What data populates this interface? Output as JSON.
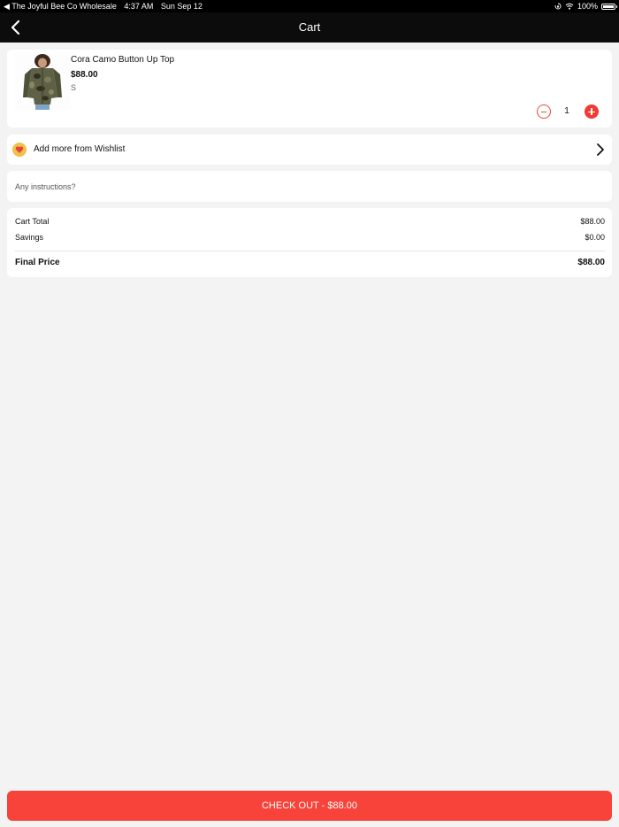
{
  "status_bar": {
    "back_app": "◀ The Joyful Bee Co Wholesale",
    "time": "4:37 AM",
    "date": "Sun Sep 12",
    "battery": "100%"
  },
  "header": {
    "title": "Cart"
  },
  "cart": {
    "items": [
      {
        "name": "Cora Camo Button Up Top",
        "price": "$88.00",
        "size": "S",
        "quantity": "1"
      }
    ]
  },
  "wishlist": {
    "label": "Add more from Wishlist"
  },
  "instructions": {
    "placeholder": "Any instructions?"
  },
  "summary": {
    "cart_total_label": "Cart Total",
    "cart_total_value": "$88.00",
    "savings_label": "Savings",
    "savings_value": "$0.00",
    "final_label": "Final Price",
    "final_value": "$88.00"
  },
  "checkout": {
    "label": "CHECK OUT - $88.00"
  },
  "colors": {
    "accent": "#f74339",
    "header_bg": "#0c0c0c",
    "page_bg": "#f3f3f3",
    "wishlist_icon_bg": "#f0c14b"
  }
}
